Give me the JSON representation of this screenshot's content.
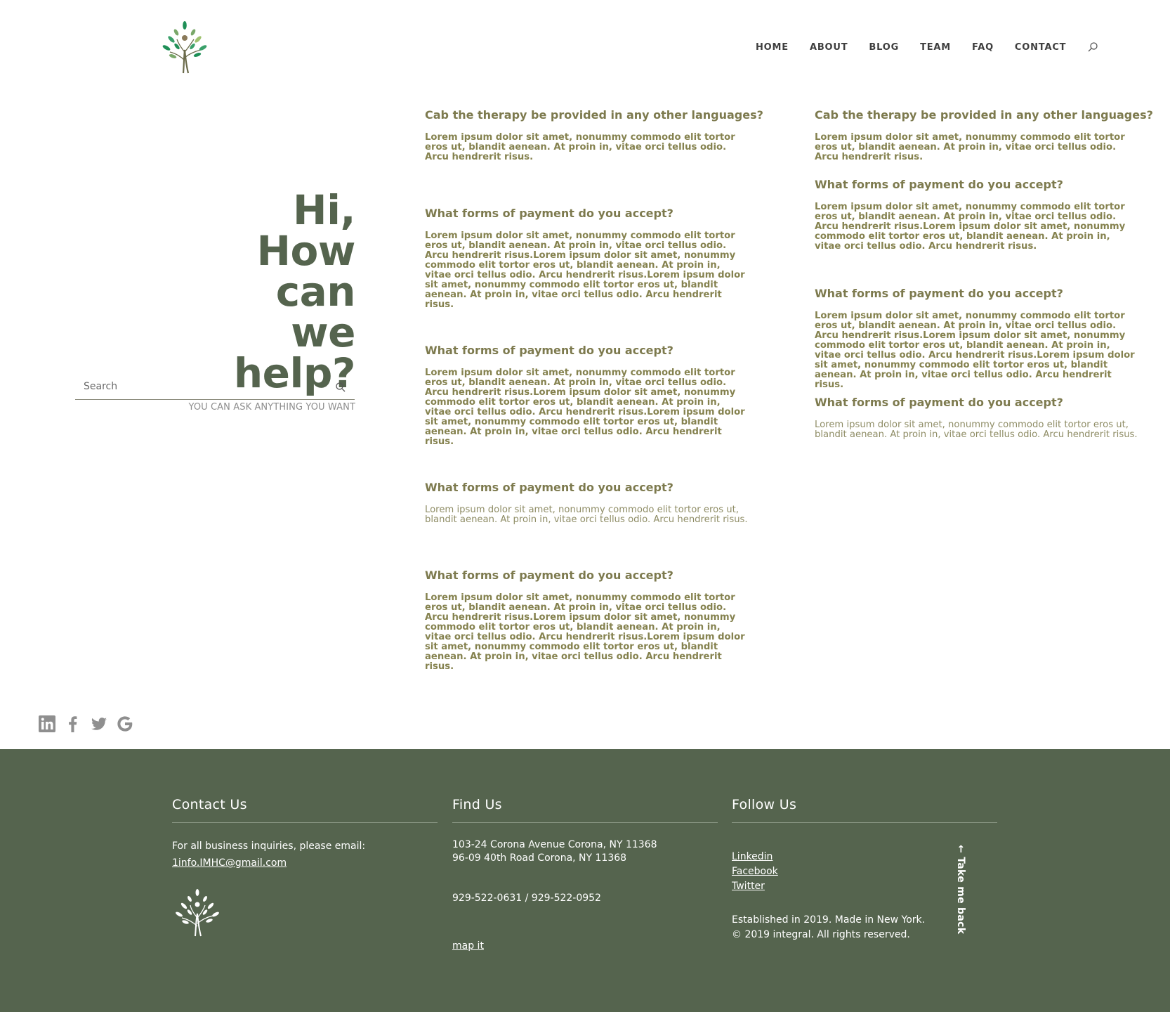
{
  "header": {
    "nav": [
      "HOME",
      "ABOUT",
      "BLOG",
      "TEAM",
      "FAQ",
      "CONTACT"
    ]
  },
  "hero": {
    "title_line1": "Hi,",
    "title_line2": "How can",
    "title_line3": "we help?",
    "subtitle": "YOU CAN ASK ANYTHING YOU WANT",
    "search_placeholder": "Search"
  },
  "faq": {
    "left": [
      {
        "q": "Cab the therapy be provided in any other languages?",
        "a": "Lorem ipsum dolor sit amet, nonummy commodo elit tortor eros ut, blandit aenean. At proin in, vitae orci tellus odio. Arcu hendrerit risus."
      },
      {
        "q": "What forms of payment do you accept?",
        "a": "Lorem ipsum dolor sit amet, nonummy commodo elit tortor eros ut, blandit aenean. At proin in, vitae orci tellus odio. Arcu hendrerit risus.Lorem ipsum dolor sit amet, nonummy commodo elit tortor eros ut, blandit aenean. At proin in, vitae orci tellus odio. Arcu hendrerit risus.Lorem ipsum dolor sit amet, nonummy commodo elit tortor eros ut, blandit aenean. At proin in, vitae orci tellus odio. Arcu hendrerit risus."
      },
      {
        "q": "What forms of payment do you accept?",
        "a": "Lorem ipsum dolor sit amet, nonummy commodo elit tortor eros ut, blandit aenean. At proin in, vitae orci tellus odio. Arcu hendrerit risus.Lorem ipsum dolor sit amet, nonummy commodo elit tortor eros ut, blandit aenean. At proin in, vitae orci tellus odio. Arcu hendrerit risus.Lorem ipsum dolor sit amet, nonummy commodo elit tortor eros ut, blandit aenean. At proin in, vitae orci tellus odio. Arcu hendrerit risus."
      },
      {
        "q": "What forms of payment do you accept?",
        "a": "Lorem ipsum dolor sit amet, nonummy commodo elit tortor eros ut, blandit aenean. At proin in, vitae orci tellus odio. Arcu hendrerit risus."
      },
      {
        "q": "What forms of payment do you accept?",
        "a": "Lorem ipsum dolor sit amet, nonummy commodo elit tortor eros ut, blandit aenean. At proin in, vitae orci tellus odio. Arcu hendrerit risus.Lorem ipsum dolor sit amet, nonummy commodo elit tortor eros ut, blandit aenean. At proin in, vitae orci tellus odio. Arcu hendrerit risus.Lorem ipsum dolor sit amet, nonummy commodo elit tortor eros ut, blandit aenean. At proin in, vitae orci tellus odio. Arcu hendrerit risus."
      }
    ],
    "right": [
      {
        "q": "Cab the therapy be provided in any other languages?",
        "a": "Lorem ipsum dolor sit amet, nonummy commodo elit tortor eros ut, blandit aenean. At proin in, vitae orci tellus odio. Arcu hendrerit risus."
      },
      {
        "q": "What forms of payment do you accept?",
        "a": "Lorem ipsum dolor sit amet, nonummy commodo elit tortor eros ut, blandit aenean. At proin in, vitae orci tellus odio. Arcu hendrerit risus.Lorem ipsum dolor sit amet, nonummy commodo elit tortor eros ut, blandit aenean. At proin in, vitae orci tellus odio. Arcu hendrerit risus."
      },
      {
        "q": "What forms of payment do you accept?",
        "a": "Lorem ipsum dolor sit amet, nonummy commodo elit tortor eros ut, blandit aenean. At proin in, vitae orci tellus odio. Arcu hendrerit risus.Lorem ipsum dolor sit amet, nonummy commodo elit tortor eros ut, blandit aenean. At proin in, vitae orci tellus odio. Arcu hendrerit risus.Lorem ipsum dolor sit amet, nonummy commodo elit tortor eros ut, blandit aenean. At proin in, vitae orci tellus odio. Arcu hendrerit risus."
      },
      {
        "q": "What forms of payment do you accept?",
        "a": "Lorem ipsum dolor sit amet, nonummy commodo elit tortor eros ut, blandit aenean. At proin in, vitae orci tellus odio. Arcu hendrerit risus."
      }
    ]
  },
  "social_icons": [
    "linkedin-icon",
    "facebook-icon",
    "twitter-icon",
    "google-icon"
  ],
  "footer": {
    "contact": {
      "title": "Contact Us",
      "text": "For all business inquiries, please email:",
      "email": "1info.IMHC@gmail.com"
    },
    "find": {
      "title": "Find Us",
      "address1": "103-24 Corona Avenue Corona, NY 11368",
      "address2": "96-09 40th Road Corona, NY 11368",
      "phone": "929-522-0631 / 929-522-0952",
      "map_link": "map it"
    },
    "follow": {
      "title": "Follow Us",
      "links": [
        "Linkedin",
        "Facebook",
        "Twitter"
      ],
      "established": "Established in 2019. Made in New York.",
      "copyright": "© 2019 integral. All rights reserved."
    },
    "back_to_top": "← Take me back"
  },
  "colors": {
    "brand_green": "#55644e",
    "faq_text": "#7d7a4e",
    "nav_text": "#3f3f3f"
  }
}
